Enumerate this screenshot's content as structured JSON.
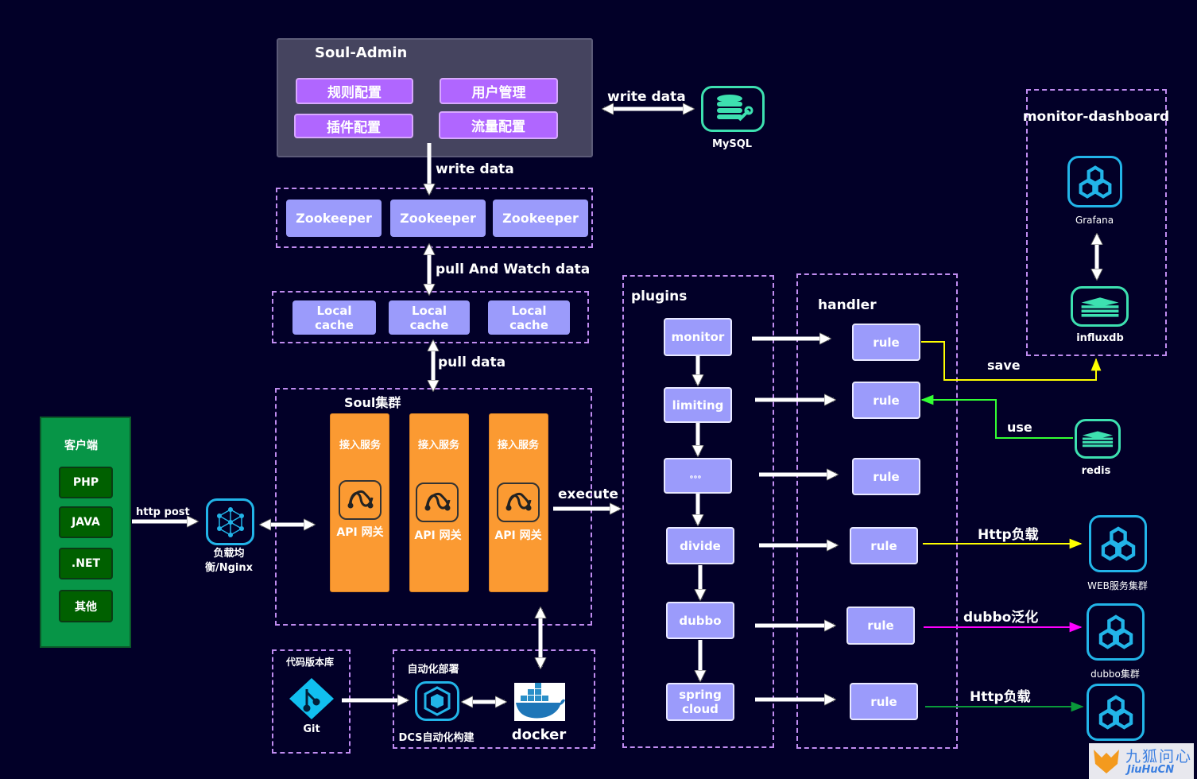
{
  "colors": {
    "background": "#020028",
    "admin_panel": "#45445f",
    "admin_button": "#b066ff",
    "node_box": "#9b9bfb",
    "gateway": "#fb9a32",
    "client_panel": "#079547",
    "client_button": "#006000",
    "dashed_border": "#c08cf0",
    "icon_blue": "#22b4e8",
    "icon_teal": "#3de0b0",
    "save_line": "#ffff00",
    "use_line": "#33ff33",
    "http_line": "#ffff00",
    "dubbo_line": "#ff00ff",
    "http2_line": "#0a9a3a"
  },
  "soul_admin": {
    "title": "Soul-Admin",
    "buttons": [
      "规则配置",
      "用户管理",
      "插件配置",
      "流量配置"
    ]
  },
  "mysql": {
    "arrow_label": "write data",
    "label": "MySQL",
    "icon": "database-icon"
  },
  "zookeeper": {
    "arrow_label": "write data",
    "nodes": [
      "Zookeeper",
      "Zookeeper",
      "Zookeeper"
    ]
  },
  "local_cache": {
    "arrow_label": "pull And Watch data",
    "nodes": [
      "Local\ncache",
      "Local\ncache",
      "Local\ncache"
    ]
  },
  "soul_cluster": {
    "arrow_label": "pull data",
    "title": "Soul集群",
    "gateways": [
      {
        "service": "接入服务",
        "label": "API 网关"
      },
      {
        "service": "接入服务",
        "label": "API 网关"
      },
      {
        "service": "接入服务",
        "label": "API 网关"
      }
    ],
    "execute_label": "execute"
  },
  "client": {
    "title": "客户端",
    "items": [
      "PHP",
      "JAVA",
      ".NET",
      "其他"
    ],
    "arrow_label": "http post"
  },
  "nginx": {
    "label_line1": "负载均",
    "label_line2": "衡/Nginx",
    "icon": "network-icon"
  },
  "git_repo": {
    "title": "代码版本库",
    "label": "Git",
    "icon": "git-icon"
  },
  "deploy": {
    "title": "自动化部署",
    "dcs_label": "DCS自动化构建",
    "docker_label": "docker"
  },
  "plugins": {
    "title": "plugins",
    "items": [
      "monitor",
      "limiting",
      "。。。",
      "divide",
      "dubbo",
      "spring\ncloud"
    ]
  },
  "handler": {
    "title": "handler",
    "items": [
      "rule",
      "rule",
      "rule",
      "rule",
      "rule",
      "rule"
    ]
  },
  "monitor_dashboard": {
    "title": "monitor-dashboard",
    "grafana": "Grafana",
    "influxdb": "influxdb"
  },
  "links": {
    "save": "save",
    "use": "use",
    "redis": "redis",
    "http1": "Http负载",
    "web_cluster": "WEB服务集群",
    "dubbo": "dubbo泛化",
    "dubbo_cluster": "dubbo集群",
    "http2": "Http负载"
  },
  "watermark": {
    "text": "九狐问心",
    "sub": "JiuHuCN"
  }
}
